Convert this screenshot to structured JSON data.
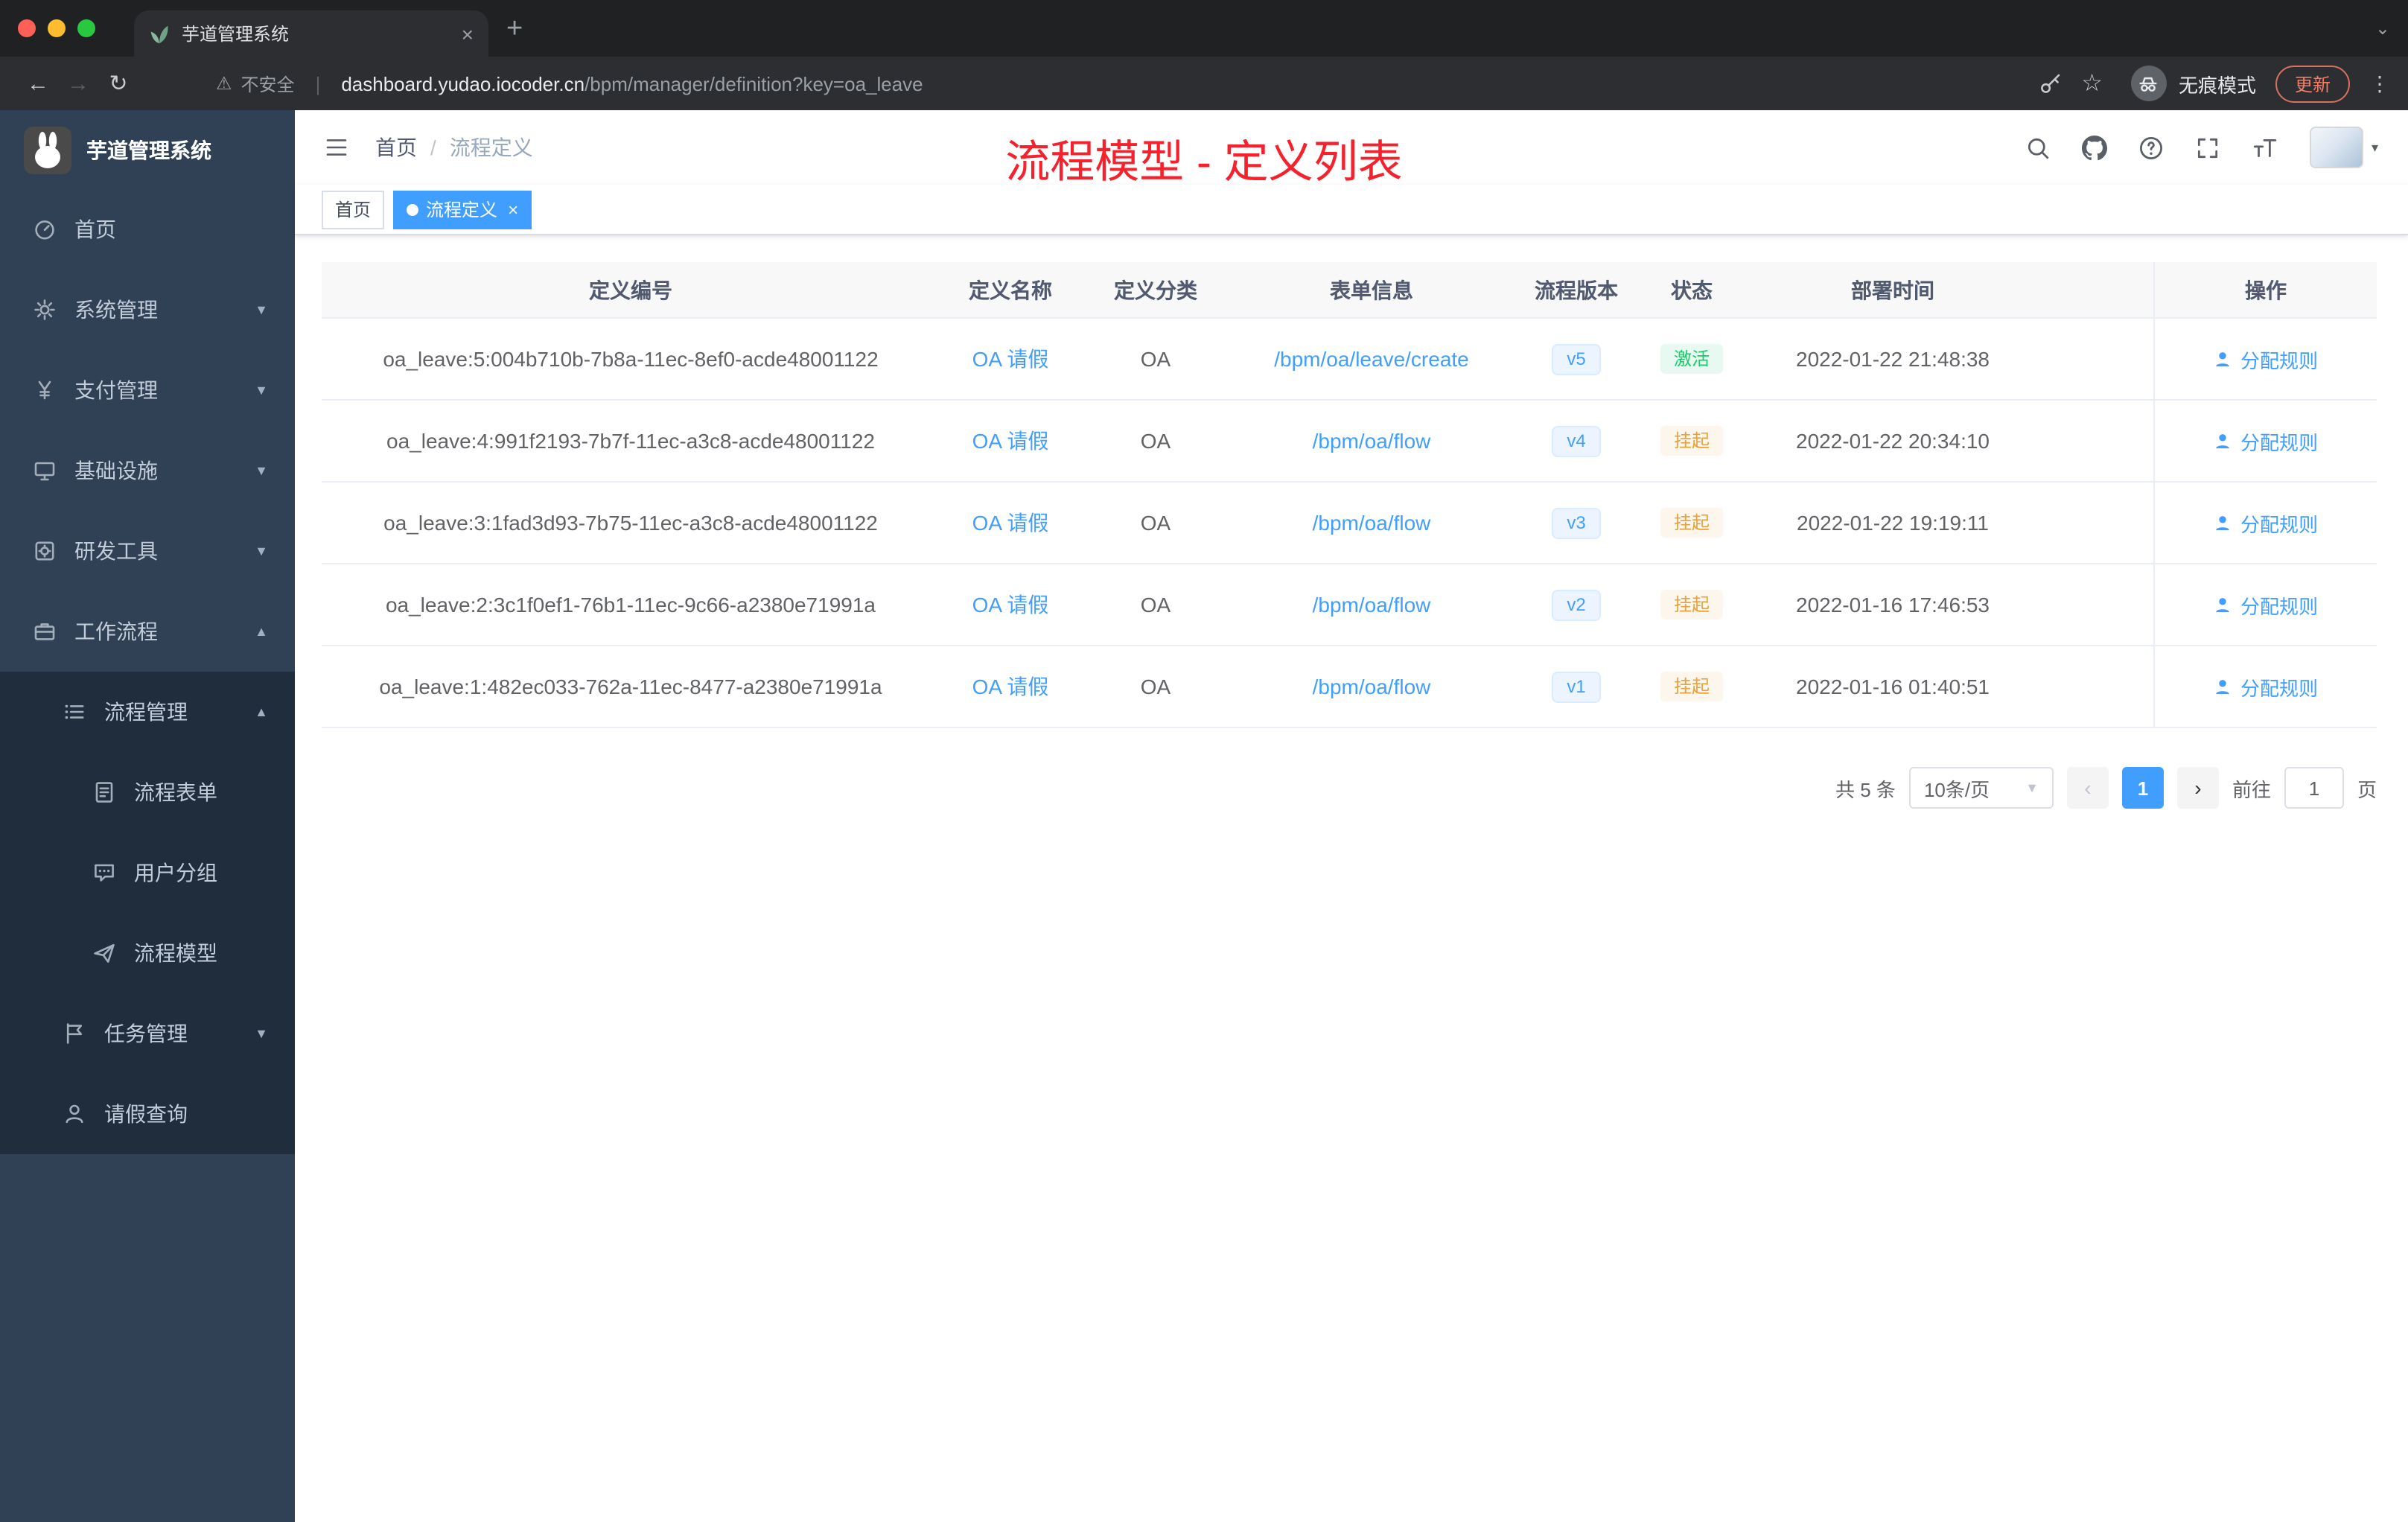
{
  "colors": {
    "accent": "#409eff",
    "success": "#13ce66",
    "warning": "#e6a23c",
    "annotation_red": "#f5222d",
    "sidebar_bg": "#304156",
    "sidebar_sub_bg": "#1f2d3d"
  },
  "browser": {
    "tab_title": "芋道管理系统",
    "security_label": "不安全",
    "url_domain": "dashboard.yudao.iocoder.cn",
    "url_path": "/bpm/manager/definition?key=oa_leave",
    "incognito_label": "无痕模式",
    "update_label": "更新"
  },
  "icons": {
    "close": "×",
    "new_tab": "+",
    "tab_search": "⌄",
    "back": "←",
    "forward": "→",
    "reload": "↻",
    "warning": "⚠",
    "star": "☆",
    "kebab": "⋮",
    "pipe": "|",
    "avatar_caret": "▾",
    "chevron_down": "▼",
    "chevron_up": "▲",
    "select_caret": "▼",
    "prev": "‹",
    "next": "›"
  },
  "sidebar": {
    "logo_title": "芋道管理系统",
    "items": [
      {
        "label": "首页",
        "icon": "dashboard-icon"
      },
      {
        "label": "系统管理",
        "icon": "gear-icon",
        "chevron": "down"
      },
      {
        "label": "支付管理",
        "icon": "yen-icon",
        "chevron": "down"
      },
      {
        "label": "基础设施",
        "icon": "monitor-icon",
        "chevron": "down"
      },
      {
        "label": "研发工具",
        "icon": "toolbox-icon",
        "chevron": "down"
      },
      {
        "label": "工作流程",
        "icon": "briefcase-icon",
        "chevron": "up"
      },
      {
        "label": "流程管理",
        "icon": "list-icon",
        "chevron": "up"
      },
      {
        "label": "流程表单",
        "icon": "form-icon"
      },
      {
        "label": "用户分组",
        "icon": "users-icon"
      },
      {
        "label": "流程模型",
        "icon": "paper-plane-icon"
      },
      {
        "label": "任务管理",
        "icon": "task-flag-icon",
        "chevron": "down"
      },
      {
        "label": "请假查询",
        "icon": "person-icon"
      }
    ]
  },
  "header": {
    "breadcrumb_root": "首页",
    "breadcrumb_sep": "/",
    "breadcrumb_current": "流程定义",
    "annotation": "流程模型 - 定义列表"
  },
  "tags": {
    "home": "首页",
    "active": "流程定义"
  },
  "table": {
    "columns": [
      "定义编号",
      "定义名称",
      "定义分类",
      "表单信息",
      "流程版本",
      "状态",
      "部署时间",
      "操作"
    ],
    "rows": [
      {
        "id": "oa_leave:5:004b710b-7b8a-11ec-8ef0-acde48001122",
        "name": "OA 请假",
        "category": "OA",
        "form": "/bpm/oa/leave/create",
        "version": "v5",
        "status": "激活",
        "time": "2022-01-22 21:48:38",
        "action": "分配规则"
      },
      {
        "id": "oa_leave:4:991f2193-7b7f-11ec-a3c8-acde48001122",
        "name": "OA 请假",
        "category": "OA",
        "form": "/bpm/oa/flow",
        "version": "v4",
        "status": "挂起",
        "time": "2022-01-22 20:34:10",
        "action": "分配规则"
      },
      {
        "id": "oa_leave:3:1fad3d93-7b75-11ec-a3c8-acde48001122",
        "name": "OA 请假",
        "category": "OA",
        "form": "/bpm/oa/flow",
        "version": "v3",
        "status": "挂起",
        "time": "2022-01-22 19:19:11",
        "action": "分配规则"
      },
      {
        "id": "oa_leave:2:3c1f0ef1-76b1-11ec-9c66-a2380e71991a",
        "name": "OA 请假",
        "category": "OA",
        "form": "/bpm/oa/flow",
        "version": "v2",
        "status": "挂起",
        "time": "2022-01-16 17:46:53",
        "action": "分配规则"
      },
      {
        "id": "oa_leave:1:482ec033-762a-11ec-8477-a2380e71991a",
        "name": "OA 请假",
        "category": "OA",
        "form": "/bpm/oa/flow",
        "version": "v1",
        "status": "挂起",
        "time": "2022-01-16 01:40:51",
        "action": "分配规则"
      }
    ]
  },
  "pagination": {
    "total": "共 5 条",
    "page_size": "10条/页",
    "current": "1",
    "goto_prefix": "前往",
    "goto_value": "1",
    "goto_suffix": "页"
  }
}
